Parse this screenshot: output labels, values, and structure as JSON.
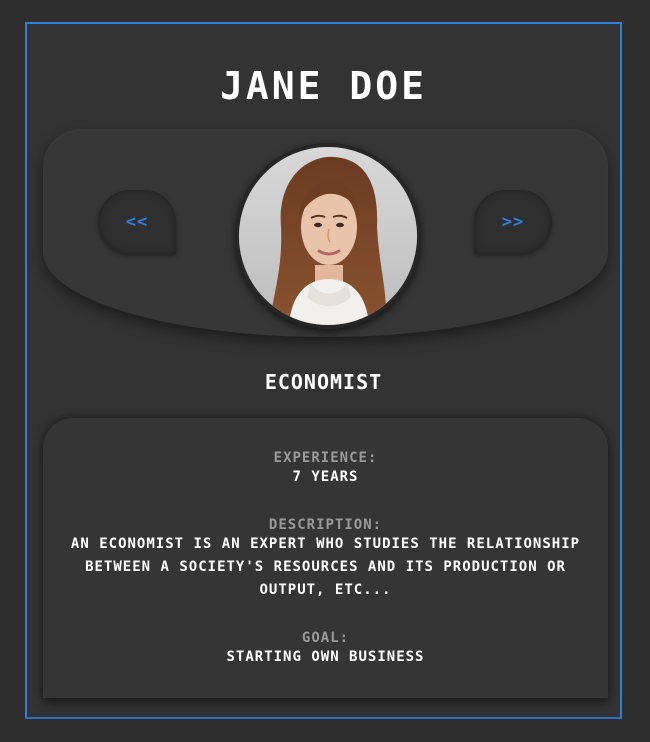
{
  "profile": {
    "name": "JANE DOE",
    "role": "ECONOMIST"
  },
  "carousel": {
    "prev_label": "<<",
    "next_label": ">>"
  },
  "details": {
    "experience_label": "EXPERIENCE:",
    "experience_value": "7 YEARS",
    "description_label": "DESCRIPTION:",
    "description_value": "AN ECONOMIST IS AN EXPERT WHO STUDIES THE RELATIONSHIP BETWEEN A SOCIETY'S RESOURCES AND ITS PRODUCTION OR OUTPUT, ETC...",
    "goal_label": "GOAL:",
    "goal_value": "STARTING OWN BUSINESS"
  },
  "colors": {
    "accent": "#2f80e0",
    "card_background": "#333333",
    "page_background": "#2e2e2e",
    "muted_text": "#9a9a9a"
  },
  "icons": {
    "prev": "double-chevron-left-icon",
    "next": "double-chevron-right-icon"
  }
}
